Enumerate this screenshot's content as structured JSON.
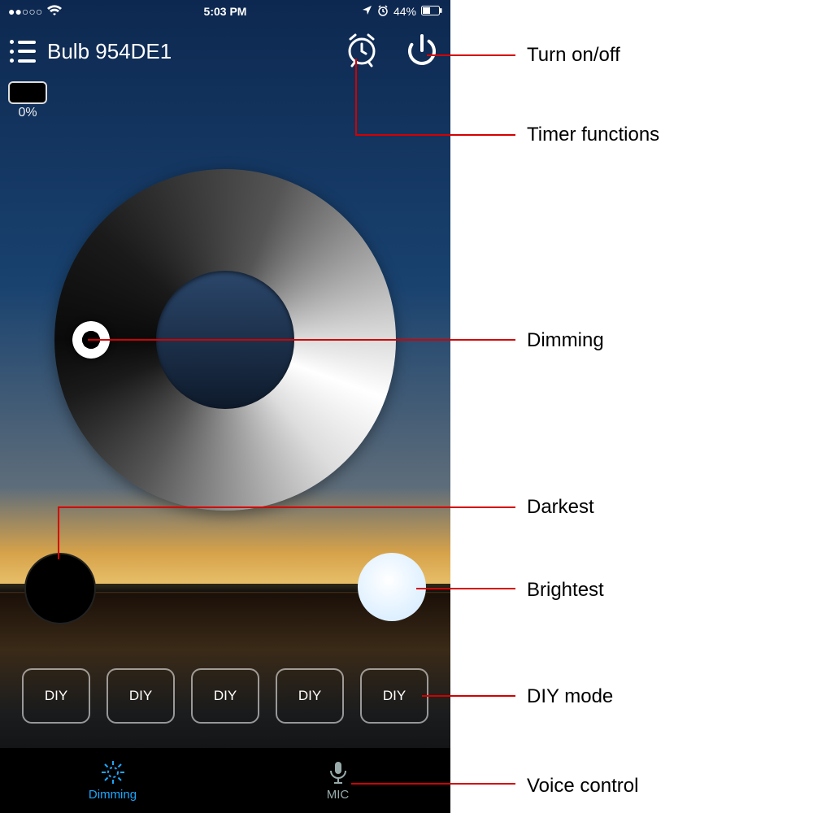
{
  "statusbar": {
    "carrier_dots": "●●○○○",
    "time": "5:03 PM",
    "battery_pct": "44%"
  },
  "navbar": {
    "title": "Bulb 954DE1"
  },
  "brightness": {
    "pct": "0%"
  },
  "diy": {
    "items": [
      "DIY",
      "DIY",
      "DIY",
      "DIY",
      "DIY"
    ]
  },
  "tabs": {
    "dimming": "Dimming",
    "mic": "MIC"
  },
  "callouts": {
    "power": "Turn on/off",
    "timer": "Timer functions",
    "dimming": "Dimming",
    "darkest": "Darkest",
    "brightest": "Brightest",
    "diy": "DIY mode",
    "voice": "Voice control"
  }
}
